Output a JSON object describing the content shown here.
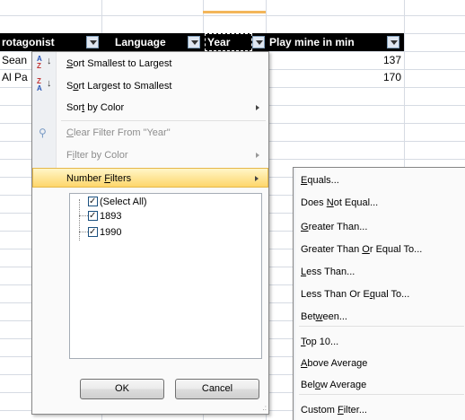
{
  "sheet": {
    "headers": {
      "protagonist": "rotagonist",
      "language": "Language",
      "year": "Year",
      "playtime": "Play mine in min"
    },
    "rows": [
      {
        "protagonist": "Sean",
        "playtime": "137"
      },
      {
        "protagonist": "Al Pa",
        "playtime": "170"
      }
    ]
  },
  "filter_menu": {
    "sort_asc": {
      "pre": "",
      "key": "S",
      "post": "ort Smallest to Largest"
    },
    "sort_desc": {
      "pre": "S",
      "key": "o",
      "post": "rt Largest to Smallest"
    },
    "sort_color": {
      "pre": "Sor",
      "key": "t",
      "post": " by Color"
    },
    "clear_filter": {
      "pre": "",
      "key": "C",
      "post": "lear Filter From \"Year\""
    },
    "filter_color": {
      "pre": "F",
      "key": "i",
      "post": "lter by Color"
    },
    "number_filters": {
      "pre": "Number ",
      "key": "F",
      "post": "ilters"
    },
    "values": [
      "(Select All)",
      "1893",
      "1990"
    ],
    "ok_label": "OK",
    "cancel_label": "Cancel",
    "grip": ".:"
  },
  "number_filters_menu": [
    {
      "pre": "",
      "key": "E",
      "post": "quals..."
    },
    {
      "pre": "Does ",
      "key": "N",
      "post": "ot Equal..."
    },
    {
      "pre": "",
      "key": "G",
      "post": "reater Than..."
    },
    {
      "pre": "Greater Than ",
      "key": "O",
      "post": "r Equal To..."
    },
    {
      "pre": "",
      "key": "L",
      "post": "ess Than..."
    },
    {
      "pre": "Less Than Or E",
      "key": "q",
      "post": "ual To..."
    },
    {
      "pre": "Bet",
      "key": "w",
      "post": "een..."
    },
    {
      "pre": "",
      "key": "T",
      "post": "op 10..."
    },
    {
      "pre": "",
      "key": "A",
      "post": "bove Average"
    },
    {
      "pre": "Bel",
      "key": "o",
      "post": "w Average"
    },
    {
      "pre": "Custom ",
      "key": "F",
      "post": "ilter..."
    }
  ],
  "colors": {
    "header_bg": "#000000",
    "highlight": "#fed66b",
    "column_accent": "#f3b65a"
  }
}
